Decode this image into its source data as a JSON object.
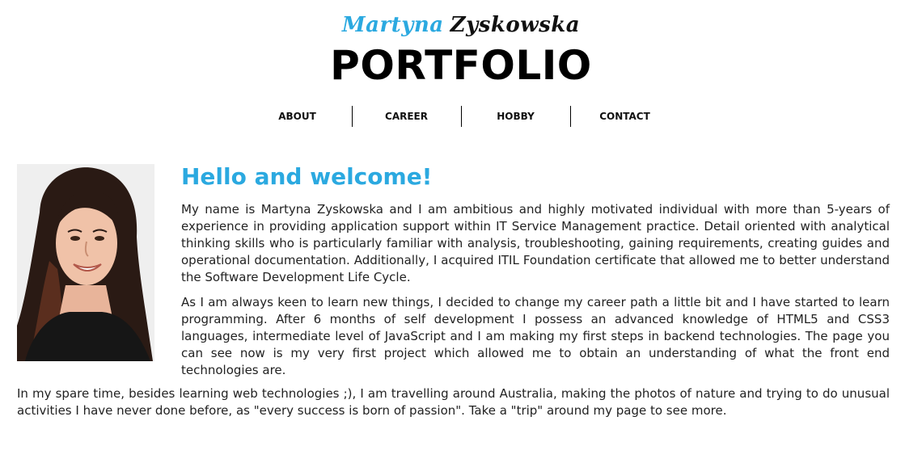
{
  "header": {
    "first_name": "Martyna",
    "last_name": "Zyskowska",
    "title": "PORTFOLIO"
  },
  "nav": {
    "items": [
      "ABOUT",
      "CAREER",
      "HOBBY",
      "CONTACT"
    ]
  },
  "main": {
    "heading": "Hello and welcome!",
    "paragraphs": [
      "My name is Martyna Zyskowska and I am ambitious and highly motivated individual with more than 5-years of experience in providing application support within IT Service Management practice. Detail oriented with analytical thinking skills who is particularly familiar with analysis, troubleshooting, gaining requirements, creating guides and operational documentation. Additionally, I acquired ITIL Foundation certificate that allowed me to better understand the Software Development Life Cycle.",
      "As I am always keen to learn new things, I decided to change my career path a little bit and I have started to learn programming. After 6 months of self development I possess an advanced knowledge of HTML5 and CSS3 languages, intermediate level of JavaScript and I am making my first steps in backend technologies. The page you can see now is my very first project which allowed me to obtain an understanding of what the front end technologies are.",
      "In my spare time, besides learning web technologies ;), I am travelling around Australia, making the photos of nature and trying to do unusual activities I have never done before, as \"every success is born of passion\". Take a \"trip\" around my page to see more."
    ]
  },
  "colors": {
    "accent": "#2ba9e0",
    "text": "#222222",
    "background": "#ffffff"
  },
  "icons": {
    "photo": "profile-photo"
  }
}
